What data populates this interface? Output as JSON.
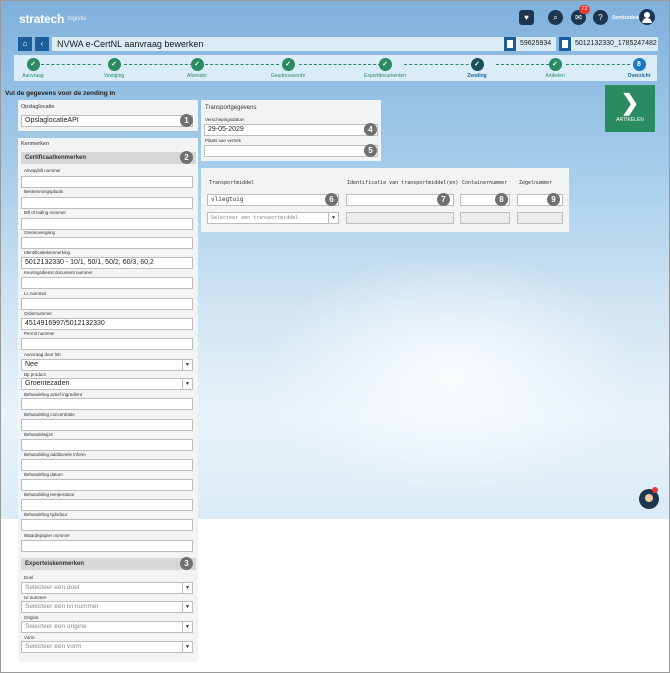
{
  "app": {
    "logo": "stratech",
    "logo_sub": "logistic",
    "notification_count": "72",
    "user_name": "Servicedesk"
  },
  "header": {
    "title": "NVWA e-CertNL aanvraag bewerken",
    "ref1": "59625934",
    "ref2": "5012132330_1785247482"
  },
  "stepper": {
    "steps": [
      {
        "label": "Aanvraag",
        "mark": "✓"
      },
      {
        "label": "Vestiging",
        "mark": "✓"
      },
      {
        "label": "Afzender",
        "mark": "✓"
      },
      {
        "label": "Geadresseerde",
        "mark": "✓"
      },
      {
        "label": "Exportdocumenten",
        "mark": "✓"
      },
      {
        "label": "Zending",
        "mark": "✓"
      },
      {
        "label": "Artikelen",
        "mark": "✓"
      },
      {
        "label": "Overzicht",
        "mark": "8"
      }
    ]
  },
  "instruction": "Vul de gegevens voor de zending in",
  "opslaglocatie": {
    "label": "Opslaglocatie",
    "value": "OpslaglocatieAPI",
    "marker": "1"
  },
  "kenmerken": {
    "label": "Kenmerken",
    "certificaat_head": "Certificaatkenmerken",
    "certificaat_marker": "2",
    "fields": [
      {
        "label": "Airwaybill nummer",
        "value": ""
      },
      {
        "label": "Bestemmingsplaats",
        "value": ""
      },
      {
        "label": "Bill of lading nummer",
        "value": ""
      },
      {
        "label": "Grensovergang",
        "value": ""
      },
      {
        "label": "Identificatiekenmerking",
        "value": "5012132330 - 10/1, 50/1, 50/2, 60/3, 60,2"
      },
      {
        "label": "Keuringsdienst document nummer",
        "value": ""
      },
      {
        "label": "Lc nummer",
        "value": ""
      },
      {
        "label": "Ordernummer",
        "value": "4514916997/5012132330"
      },
      {
        "label": "Permit nummer",
        "value": ""
      },
      {
        "label": "Aanvraag door lnb",
        "value": "Nee",
        "select": true
      },
      {
        "label": "Bp product",
        "value": "Groentezaden",
        "select": true
      },
      {
        "label": "Behandeling actief ingredient",
        "value": ""
      },
      {
        "label": "Behandeling concentratie",
        "value": ""
      },
      {
        "label": "Behandelwijze",
        "value": ""
      },
      {
        "label": "Behandeling additionele inform",
        "value": ""
      },
      {
        "label": "Behandeling datum",
        "value": ""
      },
      {
        "label": "Behandeling temperatuur",
        "value": ""
      },
      {
        "label": "Behandeling tijdsduur",
        "value": ""
      },
      {
        "label": "Waardepapier nummer",
        "value": ""
      }
    ],
    "export_head": "Exporteiskenmerken",
    "export_marker": "3",
    "export_fields": [
      {
        "label": "Doel",
        "placeholder": "Selecteer een doel"
      },
      {
        "label": "Ivi nummer",
        "placeholder": "Selecteer een ivi nummer"
      },
      {
        "label": "Origine",
        "placeholder": "Selecteer een origine"
      },
      {
        "label": "Vorm",
        "placeholder": "Selecteer een vorm"
      }
    ]
  },
  "transportgegevens": {
    "title": "Transportgegevens",
    "date_label": "Verschepingsdatum",
    "date_value": "29-05-2029",
    "date_marker": "4",
    "place_label": "Plaats van vertrek",
    "place_value": "",
    "place_marker": "5"
  },
  "transport_table": {
    "headers": [
      "Transportmiddel",
      "Identificatie van transportmiddel(en)",
      "Containernummer",
      "Zegelnummer"
    ],
    "row_value": "vliegtuig",
    "markers": [
      "6",
      "7",
      "8",
      "9"
    ],
    "new_placeholder": "Selecteer een transportmiddel"
  },
  "artikelen_button": {
    "label": "ARTIKELEN"
  },
  "colors": {
    "primary": "#1b5e9a",
    "success": "#2a8a61",
    "badge": "#e53935"
  }
}
